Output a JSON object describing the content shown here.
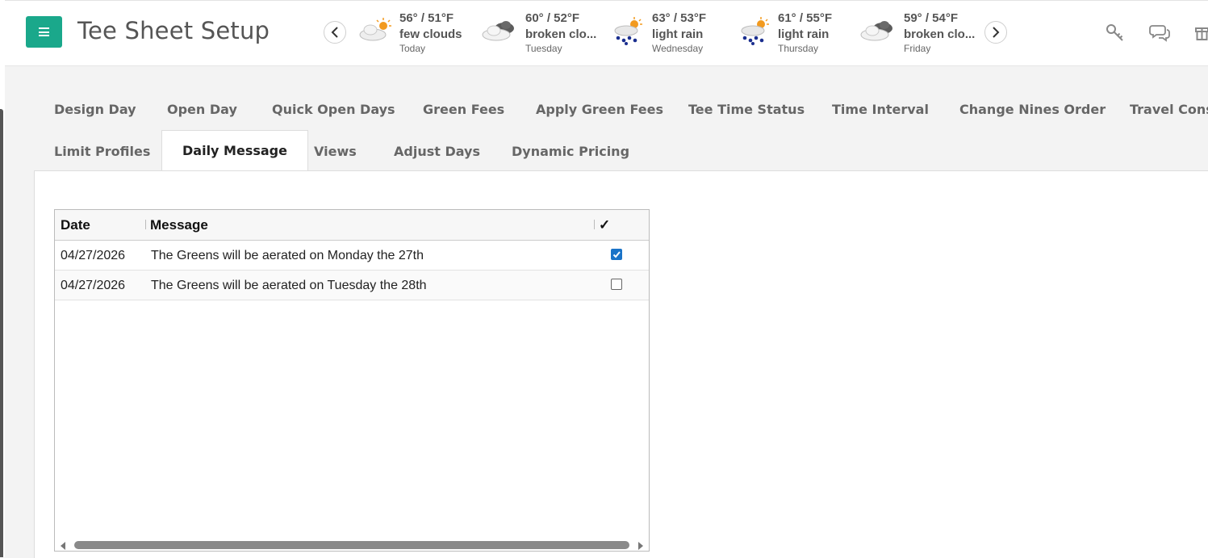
{
  "header": {
    "title": "Tee Sheet Setup",
    "accent": "#1aa88b"
  },
  "weather": [
    {
      "temps": "56° / 51°F",
      "desc": "few clouds",
      "day": "Today",
      "icon": "sun-cloud-icon"
    },
    {
      "temps": "60° / 52°F",
      "desc": "broken clo...",
      "day": "Tuesday",
      "icon": "dark-cloud-icon"
    },
    {
      "temps": "63° / 53°F",
      "desc": "light rain",
      "day": "Wednesday",
      "icon": "rain-sun-icon"
    },
    {
      "temps": "61° / 55°F",
      "desc": "light rain",
      "day": "Thursday",
      "icon": "rain-sun-icon"
    },
    {
      "temps": "59° / 54°F",
      "desc": "broken clo...",
      "day": "Friday",
      "icon": "dark-cloud-icon"
    }
  ],
  "tabs": {
    "row1": [
      "Design Day",
      "Open Day",
      "Quick Open Days",
      "Green Fees",
      "Apply Green Fees",
      "Tee Time Status",
      "Time Interval",
      "Change Nines Order",
      "Travel Const"
    ],
    "row2": [
      "Limit Profiles",
      "Daily Message",
      "Views",
      "Adjust Days",
      "Dynamic Pricing"
    ],
    "active": "Daily Message"
  },
  "grid": {
    "columns": [
      "Date",
      "Message",
      "✓"
    ],
    "rows": [
      {
        "date": "04/27/2026",
        "message": "The Greens will be aerated on Monday the 27th",
        "checked": true
      },
      {
        "date": "04/27/2026",
        "message": "The Greens will be aerated on Tuesday the 28th",
        "checked": false
      }
    ]
  }
}
